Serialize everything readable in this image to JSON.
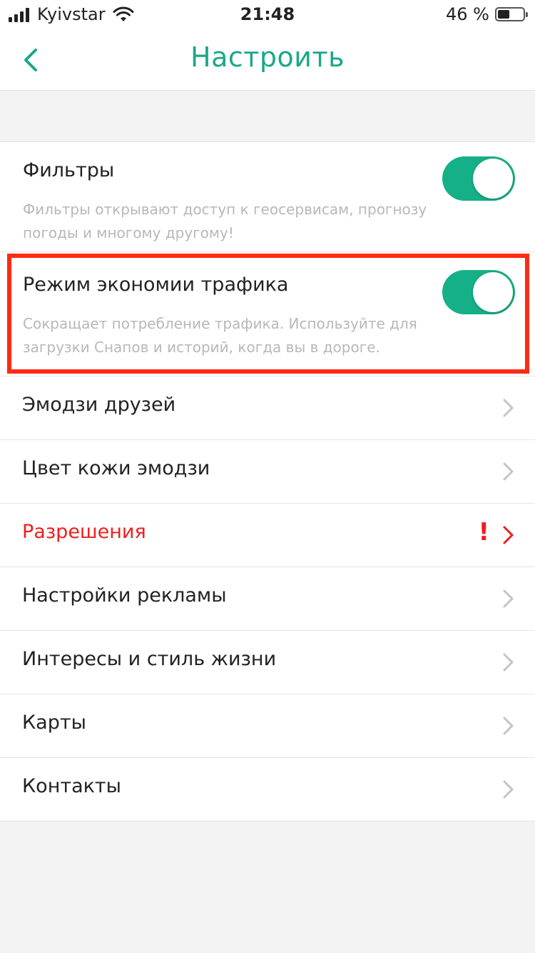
{
  "status_bar": {
    "carrier": "Kyivstar",
    "time": "21:48",
    "battery_text": "46 %",
    "battery_level": 0.46
  },
  "nav": {
    "title": "Настроить"
  },
  "toggles": [
    {
      "title": "Фильтры",
      "description": "Фильтры открывают доступ к геосервисам, прогнозу погоды и многому другому!",
      "on": true
    },
    {
      "title": "Режим экономии трафика",
      "description": "Сокращает потребление трафика. Используйте для загрузки Снапов и историй, когда вы в дороге.",
      "on": true
    }
  ],
  "items": [
    {
      "label": "Эмодзи друзей"
    },
    {
      "label": "Цвет кожи эмодзи"
    },
    {
      "label": "Разрешения",
      "alert": "!"
    },
    {
      "label": "Настройки рекламы"
    },
    {
      "label": "Интересы и стиль жизни"
    },
    {
      "label": "Карты"
    },
    {
      "label": "Контакты"
    }
  ],
  "colors": {
    "accent": "#1ba789",
    "toggle_on": "#15b088",
    "alert": "#f01e1e",
    "highlight": "#ff2a12"
  }
}
